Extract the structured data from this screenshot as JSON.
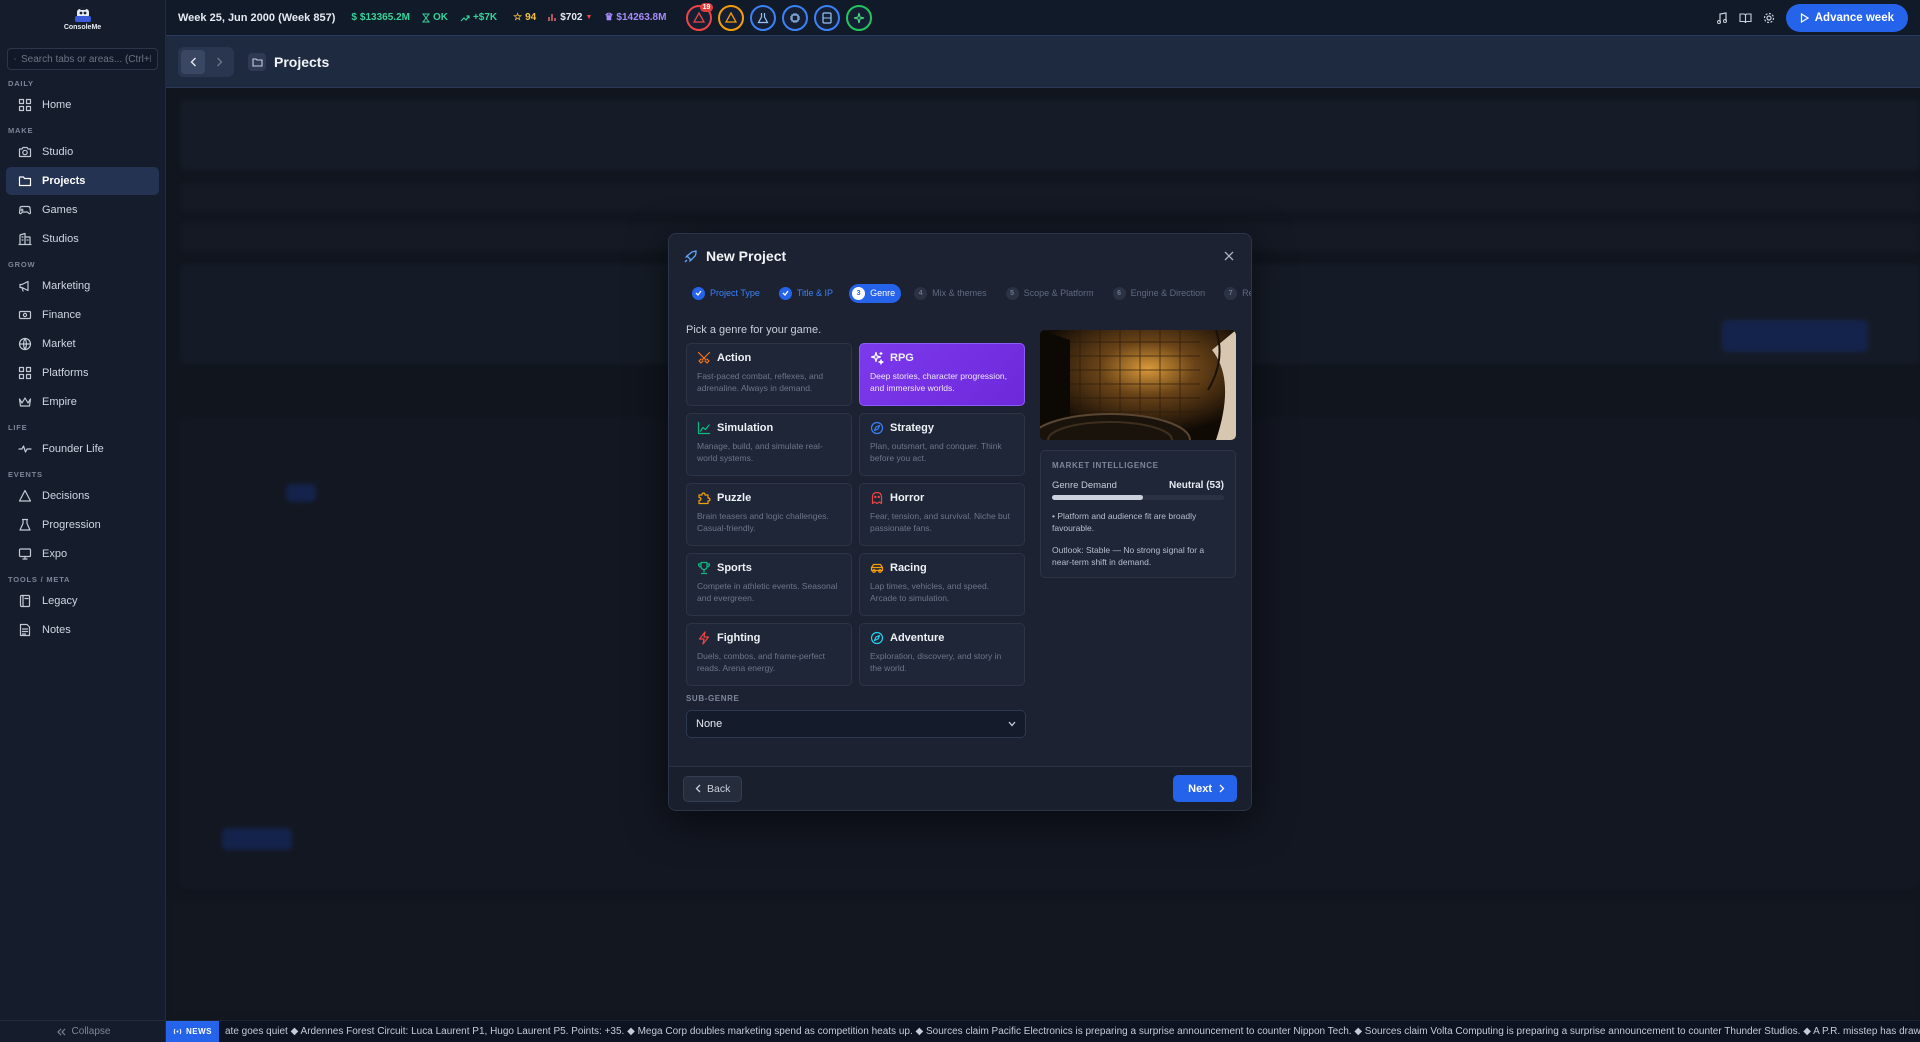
{
  "app": {
    "logo_text": "ConsoleMe"
  },
  "search": {
    "placeholder": "Search tabs or areas... (Ctrl+K)"
  },
  "sidebar": {
    "sections": [
      {
        "label": "DAILY",
        "items": [
          {
            "label": "Home",
            "icon": "grid-icon"
          }
        ]
      },
      {
        "label": "MAKE",
        "items": [
          {
            "label": "Studio",
            "icon": "camera-icon"
          },
          {
            "label": "Projects",
            "icon": "folder-icon",
            "active": true
          },
          {
            "label": "Games",
            "icon": "gamepad-icon"
          },
          {
            "label": "Studios",
            "icon": "building-icon"
          }
        ]
      },
      {
        "label": "GROW",
        "items": [
          {
            "label": "Marketing",
            "icon": "megaphone-icon"
          },
          {
            "label": "Finance",
            "icon": "banknote-icon"
          },
          {
            "label": "Market",
            "icon": "globe-icon"
          },
          {
            "label": "Platforms",
            "icon": "grid-icon"
          },
          {
            "label": "Empire",
            "icon": "crown-icon"
          }
        ]
      },
      {
        "label": "LIFE",
        "items": [
          {
            "label": "Founder Life",
            "icon": "heartbeat-icon"
          }
        ]
      },
      {
        "label": "EVENTS",
        "items": [
          {
            "label": "Decisions",
            "icon": "warning-icon"
          },
          {
            "label": "Progression",
            "icon": "flask-icon"
          },
          {
            "label": "Expo",
            "icon": "monitor-icon"
          }
        ]
      },
      {
        "label": "TOOLS / META",
        "items": [
          {
            "label": "Legacy",
            "icon": "book-icon"
          },
          {
            "label": "Notes",
            "icon": "note-icon"
          }
        ]
      }
    ],
    "collapse_label": "Collapse"
  },
  "topbar": {
    "week": "Week 25, Jun 2000 (Week 857)",
    "cash": "$13365.2M",
    "status": "OK",
    "trend": "+$7K",
    "rating": "94",
    "price": "$702",
    "empire": "$14263.8M",
    "alert_count": "19",
    "advance_label": "Advance week",
    "colors": {
      "cash": "#34d399",
      "ok": "#34d399",
      "trend": "#34d399",
      "rating": "#f5c242",
      "empire": "#a78bfa",
      "accent": "#2563eb"
    }
  },
  "page": {
    "title": "Projects"
  },
  "modal": {
    "title": "New Project",
    "steps": [
      {
        "num": "1",
        "label": "Project Type",
        "state": "done"
      },
      {
        "num": "2",
        "label": "Title & IP",
        "state": "done"
      },
      {
        "num": "3",
        "label": "Genre",
        "state": "active"
      },
      {
        "num": "4",
        "label": "Mix & themes",
        "state": "todo"
      },
      {
        "num": "5",
        "label": "Scope & Platform",
        "state": "todo"
      },
      {
        "num": "6",
        "label": "Engine & Direction",
        "state": "todo"
      },
      {
        "num": "7",
        "label": "Re",
        "state": "todo"
      }
    ],
    "prompt": "Pick a genre for your game.",
    "genres": [
      {
        "name": "Action",
        "desc": "Fast-paced combat, reflexes, and adrenaline. Always in demand.",
        "icon": "swords-icon",
        "color": "#f97316"
      },
      {
        "name": "RPG",
        "desc": "Deep stories, character progression, and immersive worlds.",
        "icon": "sparkles-icon",
        "color": "#ffffff",
        "selected": true
      },
      {
        "name": "Simulation",
        "desc": "Manage, build, and simulate real-world systems.",
        "icon": "chart-icon",
        "color": "#10b981"
      },
      {
        "name": "Strategy",
        "desc": "Plan, outsmart, and conquer. Think before you act.",
        "icon": "compass-icon",
        "color": "#3b82f6"
      },
      {
        "name": "Puzzle",
        "desc": "Brain teasers and logic challenges. Casual-friendly.",
        "icon": "puzzle-icon",
        "color": "#f59e0b"
      },
      {
        "name": "Horror",
        "desc": "Fear, tension, and survival. Niche but passionate fans.",
        "icon": "ghost-icon",
        "color": "#ef4444"
      },
      {
        "name": "Sports",
        "desc": "Compete in athletic events. Seasonal and evergreen.",
        "icon": "trophy-icon",
        "color": "#10b981"
      },
      {
        "name": "Racing",
        "desc": "Lap times, vehicles, and speed. Arcade to simulation.",
        "icon": "car-icon",
        "color": "#f59e0b"
      },
      {
        "name": "Fighting",
        "desc": "Duels, combos, and frame-perfect reads. Arena energy.",
        "icon": "bolt-icon",
        "color": "#ef4444"
      },
      {
        "name": "Adventure",
        "desc": "Exploration, discovery, and story in the world.",
        "icon": "compass-icon",
        "color": "#22d3ee"
      }
    ],
    "subgenre": {
      "label": "SUB-GENRE",
      "value": "None"
    },
    "intel": {
      "title": "MARKET INTELLIGENCE",
      "demand_label": "Genre Demand",
      "demand_value": "Neutral (53)",
      "demand_level": 0.53,
      "bullet": "• Platform and audience fit are broadly favourable.",
      "outlook": "Outlook: Stable — No strong signal for a near-term shift in demand."
    },
    "back_label": "Back",
    "next_label": "Next"
  },
  "news": {
    "tag": "NEWS",
    "text": "ate goes quiet ◆ Ardennes Forest Circuit: Luca Laurent P1, Hugo Laurent P5. Points: +35. ◆ Mega Corp doubles marketing spend as competition heats up. ◆ Sources claim Pacific Electronics is preparing a surprise announcement to counter Nippon Tech. ◆ Sources claim Volta Computing is preparing a surprise announcement to counter Thunder Studios. ◆ A P.R. misstep has drawn negative attention"
  }
}
